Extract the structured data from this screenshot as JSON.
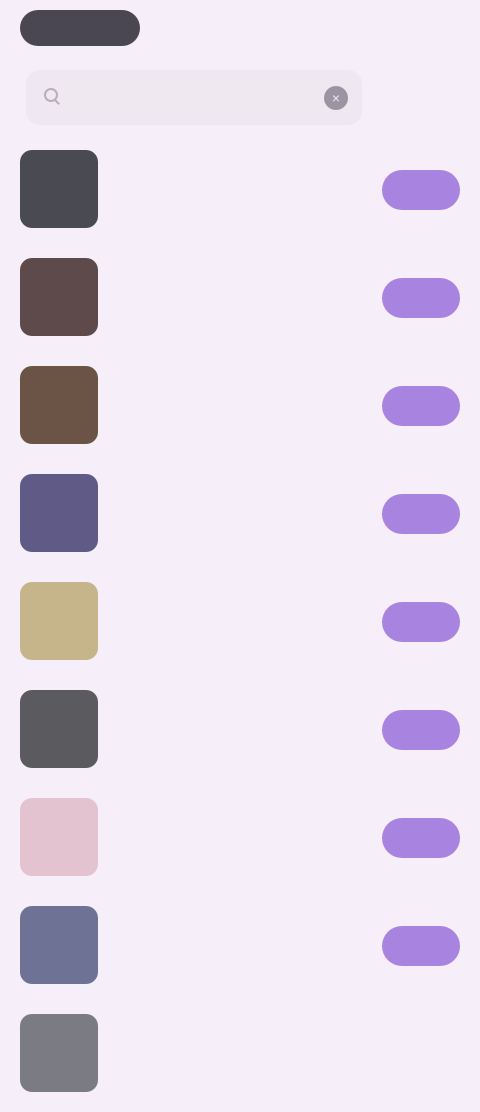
{
  "top_chip": {
    "label": ""
  },
  "search": {
    "placeholder": "",
    "value": "",
    "clear_icon": "close-icon",
    "filter_label": ""
  },
  "colors": {
    "background": "#f6eef9",
    "accent": "#a883e0",
    "chip": "#4a4652"
  },
  "items": [
    {
      "title": "",
      "subtitle": "",
      "meta": "",
      "action_label": "",
      "thumb_color": "#4a4a52"
    },
    {
      "title": "",
      "subtitle": "",
      "meta": "",
      "action_label": "",
      "thumb_color": "#5e4a4a"
    },
    {
      "title": "",
      "subtitle": "",
      "meta": "",
      "action_label": "",
      "thumb_color": "#6b5446"
    },
    {
      "title": "",
      "subtitle": "",
      "meta": "",
      "action_label": "",
      "thumb_color": "#5f5a86"
    },
    {
      "title": "",
      "subtitle": "",
      "meta": "",
      "action_label": "",
      "thumb_color": "#c6b58a"
    },
    {
      "title": "",
      "subtitle": "",
      "meta": "",
      "action_label": "",
      "thumb_color": "#5b5a5e"
    },
    {
      "title": "",
      "subtitle": "",
      "meta": "",
      "action_label": "",
      "thumb_color": "#e3c3cf"
    },
    {
      "title": "",
      "subtitle": "",
      "meta": "",
      "action_label": "",
      "thumb_color": "#6e7396"
    },
    {
      "title": "",
      "subtitle": "",
      "meta": "",
      "action_label": "",
      "thumb_color": "#7b7b84"
    }
  ]
}
